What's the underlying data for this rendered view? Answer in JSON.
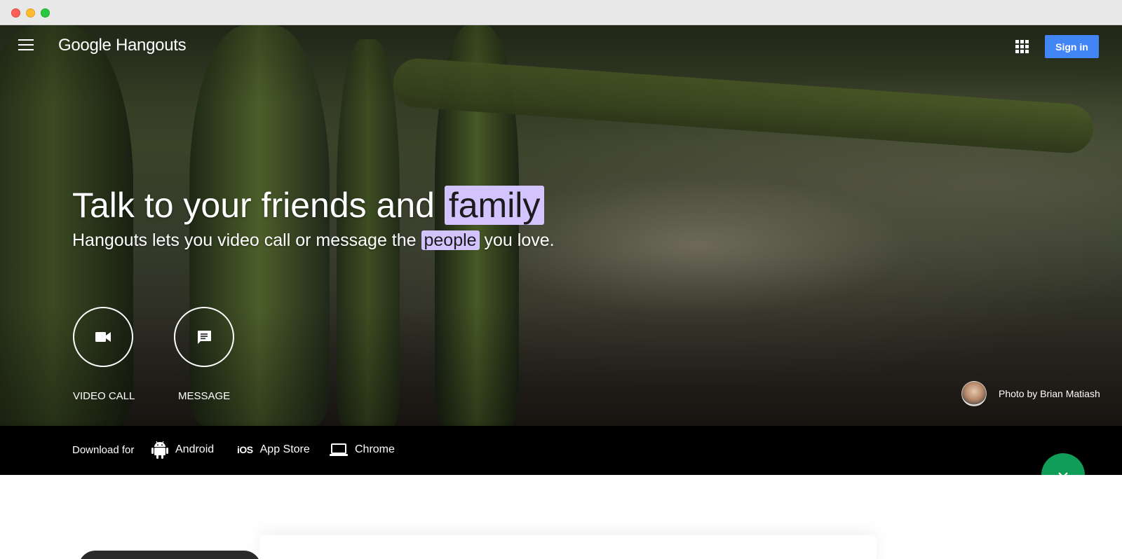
{
  "header": {
    "logo_google": "Google",
    "logo_product": "Hangouts",
    "signin_label": "Sign in"
  },
  "hero": {
    "headline_prefix": "Talk to your friends and ",
    "headline_highlight": "family",
    "subline_prefix": "Hangouts lets you video call or message the ",
    "subline_highlight": "people",
    "subline_suffix": " you love.",
    "highlight_color": "#d3c4ff",
    "actions": [
      {
        "label": "VIDEO CALL",
        "icon": "videocam-icon"
      },
      {
        "label": "MESSAGE",
        "icon": "message-icon"
      }
    ],
    "photo_credit": "Photo by Brian Matiash"
  },
  "download": {
    "label": "Download for",
    "items": [
      {
        "label": "Android",
        "icon": "android-icon"
      },
      {
        "label": "App Store",
        "icon": "ios-icon",
        "glyph": "iOS"
      },
      {
        "label": "Chrome",
        "icon": "laptop-icon"
      }
    ]
  },
  "colors": {
    "signin_bg": "#4285f4",
    "fab_bg": "#0f9d58",
    "download_bar_bg": "#000000"
  }
}
